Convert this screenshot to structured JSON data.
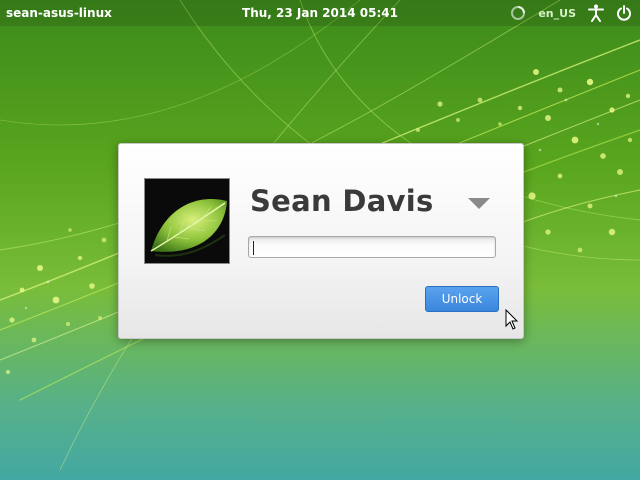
{
  "panel": {
    "hostname": "sean-asus-linux",
    "datetime": "Thu, 23 Jan 2014 05:41",
    "language": "en_US",
    "icons": [
      "session-icon",
      "accessibility-icon",
      "power-icon"
    ]
  },
  "lock_dialog": {
    "user_name": "Sean Davis",
    "avatar": "leaf-avatar",
    "password": {
      "value": "",
      "placeholder": ""
    },
    "unlock_label": "Unlock"
  },
  "colors": {
    "accent": "#3a86dc",
    "wallpaper_green": "#5aa61e",
    "wallpaper_teal": "#43a8a3"
  }
}
